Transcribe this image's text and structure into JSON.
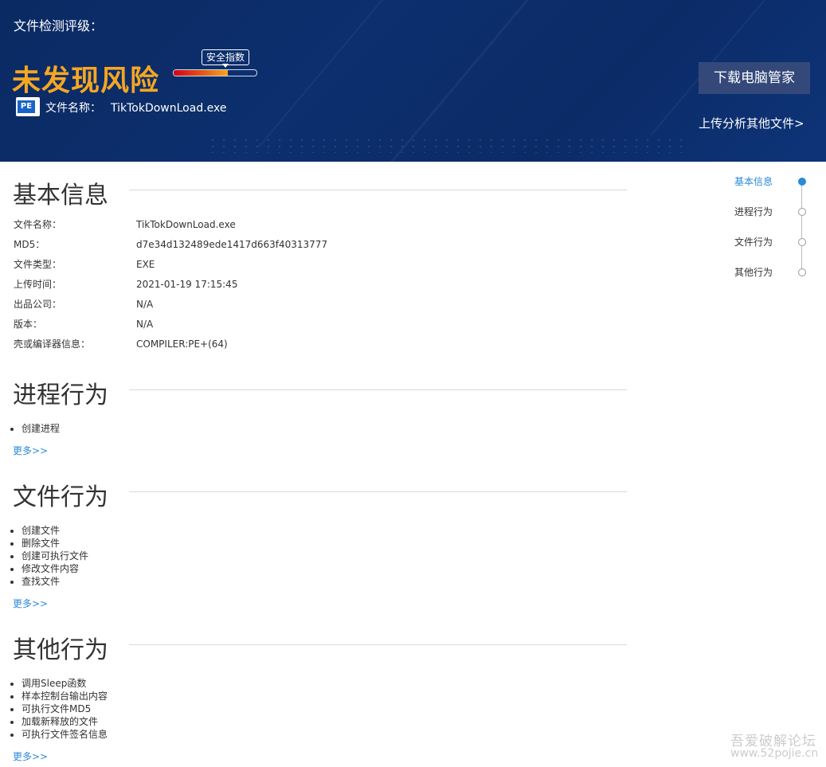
{
  "header": {
    "label": "文件检测评级：",
    "risk": "未发现风险",
    "safety_tag": "安全指数",
    "safety_level": 0.65,
    "file_icon": "PE",
    "file_label": "文件名称：",
    "file_name": "TikTokDownLoad.exe",
    "download_button": "下载电脑管家",
    "upload_link": "上传分析其他文件>"
  },
  "basic": {
    "title": "基本信息",
    "rows": [
      {
        "key": "文件名称：",
        "value": "TikTokDownLoad.exe"
      },
      {
        "key": "MD5：",
        "value": "d7e34d132489ede1417d663f40313777"
      },
      {
        "key": "文件类型：",
        "value": "EXE"
      },
      {
        "key": "上传时间：",
        "value": "2021-01-19 17:15:45"
      },
      {
        "key": "出品公司：",
        "value": "N/A"
      },
      {
        "key": "版本：",
        "value": "N/A"
      },
      {
        "key": "壳或编译器信息：",
        "value": "COMPILER:PE+(64)"
      }
    ]
  },
  "process": {
    "title": "进程行为",
    "items": [
      "创建进程"
    ],
    "more": "更多>>"
  },
  "file": {
    "title": "文件行为",
    "items": [
      "创建文件",
      "删除文件",
      "创建可执行文件",
      "修改文件内容",
      "查找文件"
    ],
    "more": "更多>>"
  },
  "other": {
    "title": "其他行为",
    "items": [
      "调用Sleep函数",
      "样本控制台输出内容",
      "可执行文件MD5",
      "加载新释放的文件",
      "可执行文件签名信息"
    ],
    "more": "更多>>"
  },
  "nav": {
    "items": [
      "基本信息",
      "进程行为",
      "文件行为",
      "其他行为"
    ],
    "active_color": "#2b8ad8"
  },
  "watermark": {
    "line1": "吾爱破解论坛",
    "line2": "www.52pojie.cn"
  }
}
